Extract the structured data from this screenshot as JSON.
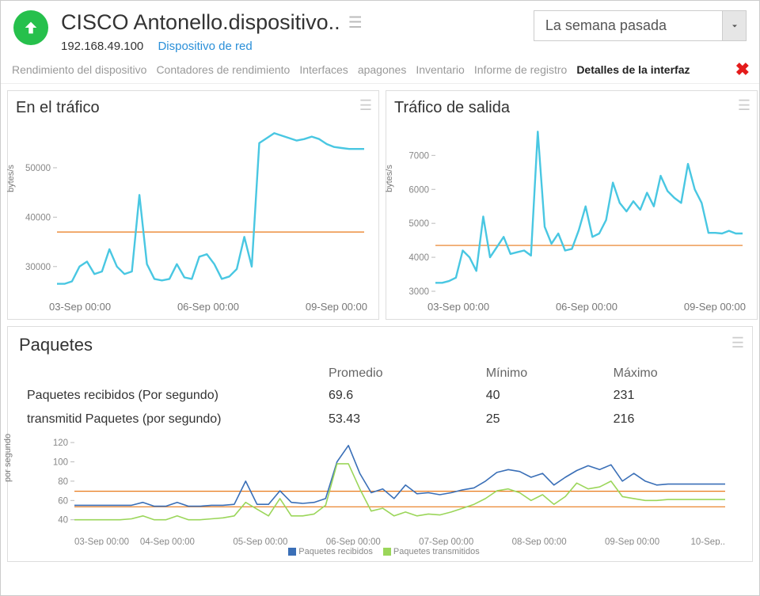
{
  "header": {
    "title": "CISCO Antonello.dispositivo..",
    "ip": "192.168.49.100",
    "type_link": "Dispositivo de red",
    "range_selected": "La semana pasada"
  },
  "tabs": [
    {
      "label": "Rendimiento del dispositivo",
      "active": false
    },
    {
      "label": "Contadores de rendimiento",
      "active": false
    },
    {
      "label": "Interfaces",
      "active": false
    },
    {
      "label": "apagones",
      "active": false
    },
    {
      "label": "Inventario",
      "active": false
    },
    {
      "label": "Informe de registro",
      "active": false
    },
    {
      "label": "Detalles de la interfaz",
      "active": true
    }
  ],
  "panel_in": {
    "title": "En el tráfico",
    "ylabel": "bytes/s",
    "yticks": [
      "50000",
      "40000",
      "30000"
    ],
    "xlabels": [
      "03-Sep 00:00",
      "06-Sep 00:00",
      "09-Sep 00:00"
    ]
  },
  "panel_out": {
    "title": "Tráfico de salida",
    "ylabel": "bytes/s",
    "yticks": [
      "7000",
      "6000",
      "5000",
      "4000",
      "3000"
    ],
    "xlabels": [
      "03-Sep 00:00",
      "06-Sep 00:00",
      "09-Sep 00:00"
    ]
  },
  "packets": {
    "title": "Paquetes",
    "headers": {
      "avg": "Promedio",
      "min": "Mínimo",
      "max": "Máximo"
    },
    "rows": [
      {
        "name": "Paquetes recibidos (Por segundo)",
        "avg": "69.6",
        "min": "40",
        "max": "231"
      },
      {
        "name": "transmitid Paquetes (por segundo)",
        "avg": "53.43",
        "min": "25",
        "max": "216"
      }
    ],
    "ylabel": "por segundo",
    "yticks": [
      "120",
      "100",
      "80",
      "60",
      "40"
    ],
    "xlabels": [
      "03-Sep 00:00",
      "04-Sep 00:00",
      "05-Sep 00:00",
      "06-Sep 00:00",
      "07-Sep 00:00",
      "08-Sep 00:00",
      "09-Sep 00:00",
      "10-Sep.."
    ],
    "legend": [
      {
        "label": "Paquetes recibidos",
        "color": "#3a6fb7"
      },
      {
        "label": "Paquetes transmitidos",
        "color": "#9bd65a"
      }
    ]
  },
  "chart_data": [
    {
      "id": "in_traffic",
      "type": "line",
      "title": "En el tráfico",
      "ylabel": "bytes/s",
      "ylim": [
        25000,
        58000
      ],
      "x": [
        0,
        1,
        2,
        3,
        4,
        5,
        6,
        7,
        8,
        9,
        10,
        11,
        12,
        13,
        14,
        15,
        16,
        17,
        18,
        19,
        20,
        21,
        22,
        23,
        24,
        25,
        26,
        27,
        28,
        29,
        30,
        31,
        32,
        33,
        34,
        35,
        36,
        37,
        38,
        39,
        40,
        41
      ],
      "series": [
        {
          "name": "bytes/s",
          "color": "#49c7e2",
          "values": [
            26500,
            26500,
            27000,
            30000,
            31000,
            28500,
            29000,
            33500,
            30000,
            28500,
            29000,
            44500,
            30500,
            27500,
            27200,
            27500,
            30500,
            27800,
            27500,
            32000,
            32500,
            30500,
            27500,
            28000,
            29500,
            36000,
            30000,
            55000,
            56000,
            57000,
            56500,
            56000,
            55500,
            55800,
            56300,
            55800,
            54800,
            54200,
            54000,
            53800,
            53800,
            53800
          ]
        }
      ],
      "avg_line": 37000,
      "x_categories": [
        "03-Sep 00:00",
        "06-Sep 00:00",
        "09-Sep 00:00"
      ]
    },
    {
      "id": "out_traffic",
      "type": "line",
      "title": "Tráfico de salida",
      "ylabel": "bytes/s",
      "ylim": [
        3000,
        7800
      ],
      "x": [
        0,
        1,
        2,
        3,
        4,
        5,
        6,
        7,
        8,
        9,
        10,
        11,
        12,
        13,
        14,
        15,
        16,
        17,
        18,
        19,
        20,
        21,
        22,
        23,
        24,
        25,
        26,
        27,
        28,
        29,
        30,
        31,
        32,
        33,
        34,
        35,
        36,
        37,
        38,
        39,
        40,
        41,
        42,
        43,
        44,
        45
      ],
      "series": [
        {
          "name": "bytes/s",
          "color": "#49c7e2",
          "values": [
            3250,
            3250,
            3300,
            3400,
            4200,
            4000,
            3600,
            5200,
            4000,
            4300,
            4600,
            4100,
            4150,
            4200,
            4050,
            7700,
            4900,
            4400,
            4700,
            4200,
            4250,
            4800,
            5500,
            4600,
            4700,
            5100,
            6200,
            5600,
            5350,
            5650,
            5400,
            5900,
            5500,
            6400,
            5950,
            5750,
            5600,
            6750,
            6000,
            5600,
            4720,
            4720,
            4700,
            4780,
            4700,
            4700
          ]
        }
      ],
      "avg_line": 4350,
      "x_categories": [
        "03-Sep 00:00",
        "06-Sep 00:00",
        "09-Sep 00:00"
      ]
    },
    {
      "id": "packets",
      "type": "line",
      "title": "Paquetes",
      "ylabel": "por segundo",
      "ylim": [
        25,
        125
      ],
      "x": [
        0,
        1,
        2,
        3,
        4,
        5,
        6,
        7,
        8,
        9,
        10,
        11,
        12,
        13,
        14,
        15,
        16,
        17,
        18,
        19,
        20,
        21,
        22,
        23,
        24,
        25,
        26,
        27,
        28,
        29,
        30,
        31,
        32,
        33,
        34,
        35,
        36,
        37,
        38,
        39,
        40,
        41,
        42,
        43,
        44,
        45,
        46,
        47,
        48,
        49,
        50,
        51,
        52,
        53,
        54,
        55,
        56,
        57
      ],
      "series": [
        {
          "name": "Paquetes recibidos",
          "color": "#3a6fb7",
          "avg": 69.6,
          "values": [
            55,
            55,
            55,
            55,
            55,
            55,
            58,
            54,
            54,
            58,
            54,
            54,
            55,
            55,
            56,
            80,
            56,
            56,
            70,
            58,
            57,
            58,
            62,
            100,
            117,
            88,
            68,
            72,
            62,
            76,
            67,
            68,
            66,
            68,
            71,
            73,
            80,
            89,
            92,
            90,
            84,
            88,
            76,
            84,
            91,
            96,
            92,
            97,
            80,
            88,
            80,
            76,
            77,
            77,
            77,
            77,
            77,
            77
          ]
        },
        {
          "name": "Paquetes transmitidos",
          "color": "#9bd65a",
          "avg": 53.43,
          "values": [
            40,
            40,
            40,
            40,
            40,
            41,
            44,
            40,
            40,
            44,
            40,
            40,
            41,
            42,
            44,
            58,
            51,
            44,
            62,
            44,
            44,
            46,
            55,
            98,
            98,
            72,
            49,
            52,
            44,
            48,
            44,
            46,
            45,
            48,
            52,
            56,
            62,
            70,
            72,
            68,
            60,
            66,
            56,
            64,
            78,
            72,
            74,
            80,
            64,
            62,
            60,
            60,
            61,
            61,
            61,
            61,
            61,
            61
          ]
        }
      ],
      "avg_lines": [
        69.6,
        53.43
      ],
      "x_categories": [
        "03-Sep 00:00",
        "04-Sep 00:00",
        "05-Sep 00:00",
        "06-Sep 00:00",
        "07-Sep 00:00",
        "08-Sep 00:00",
        "09-Sep 00:00"
      ]
    }
  ]
}
